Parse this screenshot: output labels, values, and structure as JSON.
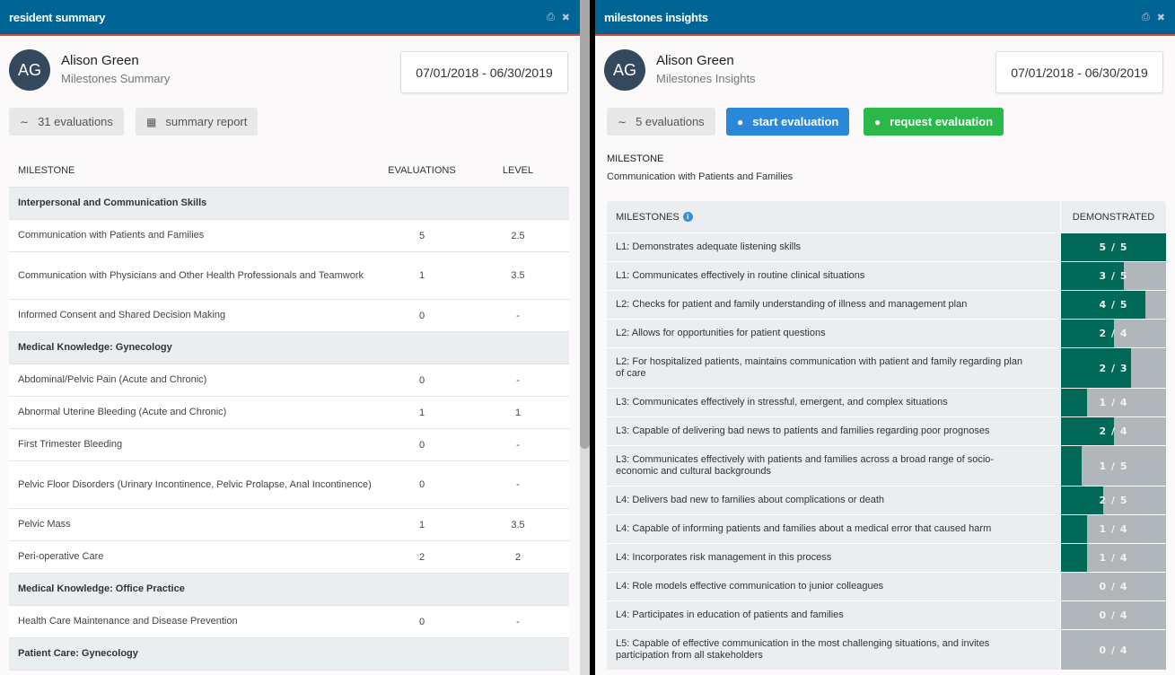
{
  "left_panel": {
    "title": "resident summary",
    "profile": {
      "initials": "AG",
      "name": "Alison Green",
      "subtitle": "Milestones Summary"
    },
    "date_range": "07/01/2018 - 06/30/2019",
    "buttons": {
      "evaluations": "31 evaluations",
      "summary_report": "summary report"
    },
    "table": {
      "columns": [
        "MILESTONE",
        "EVALUATIONS",
        "LEVEL"
      ],
      "rows": [
        {
          "type": "group",
          "label": "Interpersonal and Communication Skills"
        },
        {
          "type": "item",
          "label": "Communication with Patients and Families",
          "evaluations": "5",
          "level": "2.5"
        },
        {
          "type": "item",
          "label": "Communication with Physicians and Other Health Professionals and Teamwork",
          "evaluations": "1",
          "level": "3.5"
        },
        {
          "type": "item",
          "label": "Informed Consent and Shared Decision Making",
          "evaluations": "0",
          "level": "-"
        },
        {
          "type": "group",
          "label": "Medical Knowledge: Gynecology"
        },
        {
          "type": "item",
          "label": "Abdominal/Pelvic Pain (Acute and Chronic)",
          "evaluations": "0",
          "level": "-"
        },
        {
          "type": "item",
          "label": "Abnormal Uterine Bleeding (Acute and Chronic)",
          "evaluations": "1",
          "level": "1"
        },
        {
          "type": "item",
          "label": "First Trimester Bleeding",
          "evaluations": "0",
          "level": "-"
        },
        {
          "type": "item",
          "label": "Pelvic Floor Disorders (Urinary Incontinence, Pelvic Prolapse, Anal Incontinence)",
          "evaluations": "0",
          "level": "-"
        },
        {
          "type": "item",
          "label": "Pelvic Mass",
          "evaluations": "1",
          "level": "3.5"
        },
        {
          "type": "item",
          "label": "Peri-operative Care",
          "evaluations": "2",
          "level": "2"
        },
        {
          "type": "group",
          "label": "Medical Knowledge: Office Practice"
        },
        {
          "type": "item",
          "label": "Health Care Maintenance and Disease Prevention",
          "evaluations": "0",
          "level": "-"
        },
        {
          "type": "group",
          "label": "Patient Care: Gynecology"
        }
      ]
    }
  },
  "right_panel": {
    "title": "milestones insights",
    "profile": {
      "initials": "AG",
      "name": "Alison Green",
      "subtitle": "Milestones Insights"
    },
    "date_range": "07/01/2018 - 06/30/2019",
    "buttons": {
      "evaluations": "5 evaluations",
      "start_evaluation": "start evaluation",
      "request_evaluation": "request evaluation"
    },
    "milestone_label": "MILESTONE",
    "milestone_value": "Communication with Patients and Families",
    "table": {
      "columns": [
        "MILESTONES",
        "DEMONSTRATED"
      ],
      "rows": [
        {
          "label": "L1: Demonstrates adequate listening skills",
          "done": 5,
          "total": 5,
          "text": "5/5"
        },
        {
          "label": "L1: Communicates effectively in routine clinical situations",
          "done": 3,
          "total": 5,
          "text": "3/5"
        },
        {
          "label": "L2: Checks for patient and family understanding of illness and management plan",
          "done": 4,
          "total": 5,
          "text": "4/5"
        },
        {
          "label": "L2: Allows for opportunities for patient questions",
          "done": 2,
          "total": 4,
          "text": "2/4"
        },
        {
          "label": "L2: For hospitalized patients, maintains communication with patient and family regarding plan of care",
          "done": 2,
          "total": 3,
          "text": "2/3"
        },
        {
          "label": "L3: Communicates effectively in stressful, emergent, and complex situations",
          "done": 1,
          "total": 4,
          "text": "1/4"
        },
        {
          "label": "L3: Capable of delivering bad news to patients and families regarding poor prognoses",
          "done": 2,
          "total": 4,
          "text": "2/4"
        },
        {
          "label": "L3: Communicates effectively with patients and families across a broad range of socio-economic and cultural backgrounds",
          "done": 1,
          "total": 5,
          "text": "1/5"
        },
        {
          "label": "L4: Delivers bad new to families about complications or death",
          "done": 2,
          "total": 5,
          "text": "2/5"
        },
        {
          "label": "L4: Capable of informing patients and families about a medical error that caused harm",
          "done": 1,
          "total": 4,
          "text": "1/4"
        },
        {
          "label": "L4: Incorporates risk management in this process",
          "done": 1,
          "total": 4,
          "text": "1/4"
        },
        {
          "label": "L4: Role models effective communication to junior colleagues",
          "done": 0,
          "total": 4,
          "text": "0/4"
        },
        {
          "label": "L4: Participates in education of patients and families",
          "done": 0,
          "total": 4,
          "text": "0/4"
        },
        {
          "label": "L5: Capable of effective communication in the most challenging situations, and invites participation from all stakeholders",
          "done": 0,
          "total": 4,
          "text": "0/4"
        }
      ]
    }
  },
  "colors": {
    "header": "#006495",
    "accent_line": "#d04b4b",
    "bar_fill": "#006957",
    "bar_empty": "#b0b6ba",
    "btn_blue": "#2b88d8",
    "btn_green": "#2ab84a"
  }
}
